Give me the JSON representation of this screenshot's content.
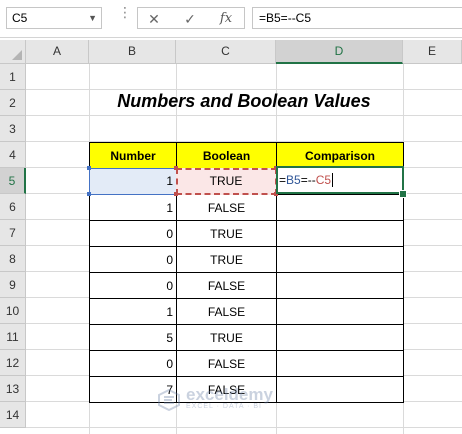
{
  "formula_bar": {
    "name_box": "C5",
    "cancel_icon": "✕",
    "enter_icon": "✓",
    "fx_label": "fx",
    "formula": "=B5=--C5"
  },
  "columns": [
    "A",
    "B",
    "C",
    "D",
    "E"
  ],
  "rows": [
    "1",
    "2",
    "3",
    "4",
    "5",
    "6",
    "7",
    "8",
    "9",
    "10",
    "11",
    "12",
    "13",
    "14"
  ],
  "title": "Numbers and Boolean Values",
  "table": {
    "headers": [
      "Number",
      "Boolean",
      "Comparison"
    ],
    "rows": [
      {
        "number": "1",
        "boolean": "TRUE",
        "comparison": ""
      },
      {
        "number": "1",
        "boolean": "FALSE",
        "comparison": ""
      },
      {
        "number": "0",
        "boolean": "TRUE",
        "comparison": ""
      },
      {
        "number": "0",
        "boolean": "TRUE",
        "comparison": ""
      },
      {
        "number": "0",
        "boolean": "FALSE",
        "comparison": ""
      },
      {
        "number": "1",
        "boolean": "FALSE",
        "comparison": ""
      },
      {
        "number": "5",
        "boolean": "TRUE",
        "comparison": ""
      },
      {
        "number": "0",
        "boolean": "FALSE",
        "comparison": ""
      },
      {
        "number": "7",
        "boolean": "FALSE",
        "comparison": ""
      }
    ]
  },
  "editing": {
    "part1": "=",
    "ref_b": "B5",
    "op": "=--",
    "ref_c": "C5"
  },
  "watermark": {
    "name": "exceldemy",
    "tag": "EXCEL · DATA · BI"
  },
  "colors": {
    "accent": "#217346",
    "header_fill": "#ffff00",
    "ref_b": "#4472c4",
    "ref_c": "#c0504d"
  }
}
